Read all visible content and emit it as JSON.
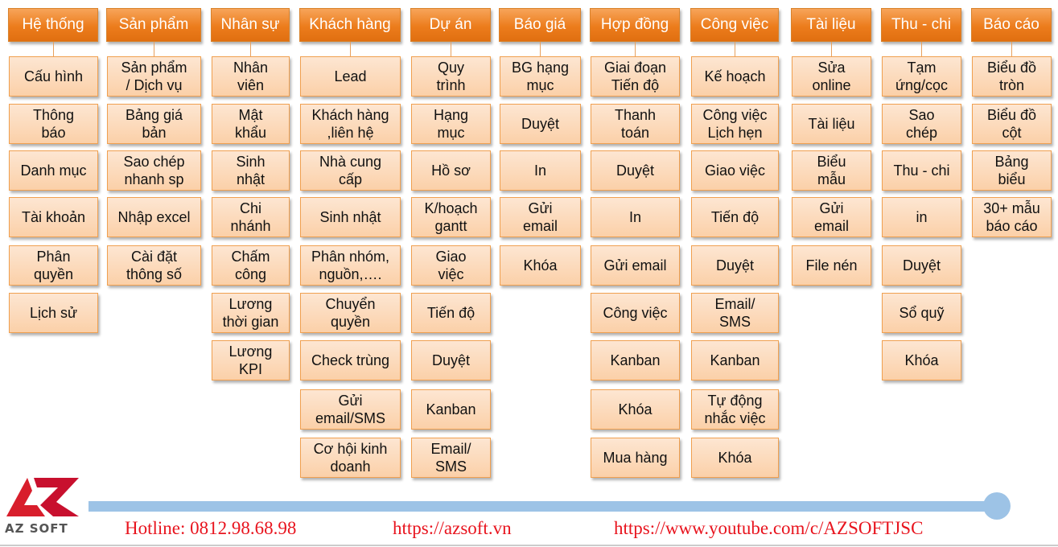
{
  "columns": [
    {
      "title": "Hệ thống",
      "items": [
        "Cấu hình",
        "Thông\nbáo",
        "Danh mục",
        "Tài khoản",
        "Phân\nquyền",
        "Lịch sử"
      ]
    },
    {
      "title": "Sản phẩm",
      "items": [
        "Sản phẩm\n/ Dịch vụ",
        "Bảng giá\nbản",
        "Sao chép\nnhanh sp",
        "Nhập excel",
        "Cài đặt\nthông số"
      ]
    },
    {
      "title": "Nhân sự",
      "items": [
        "Nhân\nviên",
        "Mật\nkhẩu",
        "Sinh\nnhật",
        "Chi\nnhánh",
        "Chấm\ncông",
        "Lương\nthời gian",
        "Lương\nKPI"
      ]
    },
    {
      "title": "Khách hàng",
      "items": [
        "Lead",
        "Khách hàng\n,liên hệ",
        "Nhà cung\ncấp",
        "Sinh nhật",
        "Phân nhóm,\nnguồn,….",
        "Chuyển\nquyền",
        "Check trùng",
        "Gửi\nemail/SMS",
        "Cơ hội kinh\ndoanh"
      ]
    },
    {
      "title": "Dự án",
      "items": [
        "Quy\ntrình",
        "Hạng\nmục",
        "Hồ sơ",
        "K/hoạch\ngantt",
        "Giao\nviệc",
        "Tiến độ",
        "Duyệt",
        "Kanban",
        "Email/\nSMS"
      ]
    },
    {
      "title": "Báo giá",
      "items": [
        "BG hạng\nmục",
        "Duyệt",
        "In",
        "Gửi\nemail",
        "Khóa"
      ]
    },
    {
      "title": "Hợp đồng",
      "items": [
        "Giai đoạn\nTiến độ",
        "Thanh\ntoán",
        "Duyệt",
        "In",
        "Gửi email",
        "Công việc",
        "Kanban",
        "Khóa",
        "Mua hàng"
      ]
    },
    {
      "title": "Công việc",
      "items": [
        "Kế hoạch",
        "Công việc\nLịch hẹn",
        "Giao việc",
        "Tiến độ",
        "Duyệt",
        "Email/\nSMS",
        "Kanban",
        "Tự động\nnhắc việc",
        "Khóa"
      ]
    },
    {
      "title": "Tài liệu",
      "items": [
        "Sửa\nonline",
        "Tài liệu",
        "Biểu\nmẫu",
        "Gửi\nemail",
        "File nén"
      ]
    },
    {
      "title": "Thu - chi",
      "items": [
        "Tạm\nứng/cọc",
        "Sao\nchép",
        "Thu - chi",
        "in",
        "Duyệt",
        "Sổ quỹ",
        "Khóa"
      ]
    },
    {
      "title": "Báo cáo",
      "items": [
        "Biểu đồ\ntròn",
        "Biểu đồ\ncột",
        "Bảng\nbiểu",
        "30+ mẫu\nbáo cáo"
      ]
    }
  ],
  "footer": {
    "logo_text": "AZ SOFT",
    "hotline": "Hotline: 0812.98.68.98",
    "website": "https://azsoft.vn",
    "youtube": "https://www.youtube.com/c/AZSOFTJSC"
  },
  "colors": {
    "header": "#ec7c1c",
    "box": "#fcdcbc",
    "accent_red": "#e8141e",
    "bar": "#9dc3e6"
  }
}
